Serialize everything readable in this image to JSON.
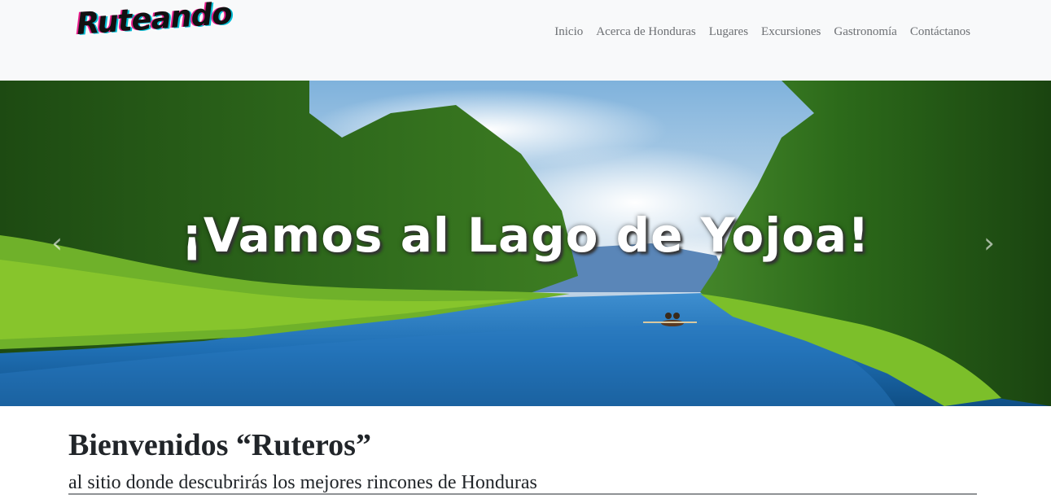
{
  "brand": {
    "logo_text": "Ruteando"
  },
  "nav": {
    "items": [
      {
        "label": "Inicio"
      },
      {
        "label": "Acerca de Honduras"
      },
      {
        "label": "Lugares"
      },
      {
        "label": "Excursiones"
      },
      {
        "label": "Gastronomía"
      },
      {
        "label": "Contáctanos"
      }
    ]
  },
  "hero": {
    "caption": "¡Vamos al Lago de Yojoa!",
    "prev_icon": "chevron-left-icon",
    "next_icon": "chevron-right-icon",
    "prev_glyph": "‹",
    "next_glyph": "›"
  },
  "welcome": {
    "title": "Bienvenidos “Ruteros”",
    "subtitle": "al sitio donde descubrirás los mejores rincones de Honduras"
  },
  "colors": {
    "navbar_bg": "#f8f9fa",
    "nav_text": "#6c6f73",
    "heading_text": "#212529",
    "rule": "#8f9295"
  }
}
